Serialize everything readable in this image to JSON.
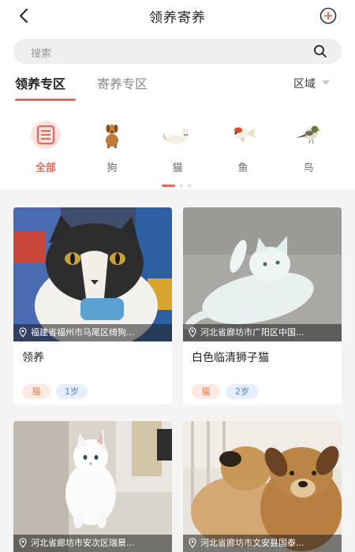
{
  "header": {
    "title": "领养寄养",
    "back_icon": "back-arrow-icon",
    "add_icon": "plus-circle-icon"
  },
  "search": {
    "placeholder": "搜索",
    "icon": "search-icon"
  },
  "tabs": [
    {
      "label": "领养专区",
      "active": true
    },
    {
      "label": "寄养专区",
      "active": false
    }
  ],
  "region": {
    "label": "区域"
  },
  "categories": [
    {
      "label": "全部",
      "icon": "all-list-icon",
      "active": true
    },
    {
      "label": "狗",
      "icon": "dog-icon",
      "active": false
    },
    {
      "label": "猫",
      "icon": "cat-icon",
      "active": false
    },
    {
      "label": "鱼",
      "icon": "fish-icon",
      "active": false
    },
    {
      "label": "鸟",
      "icon": "bird-icon",
      "active": false
    }
  ],
  "pager": {
    "pages": 3,
    "current": 1
  },
  "cards": [
    {
      "location": "福建省福州市马尾区绮狗...",
      "title": "领养",
      "type": "猫",
      "age": "1岁"
    },
    {
      "location": "河北省廊坊市广阳区中国...",
      "title": "白色临清狮子猫",
      "type": "猫",
      "age": "2岁"
    },
    {
      "location": "河北省廊坊市安次区瑞景..."
    },
    {
      "location": "河北省廊坊市文安县国泰..."
    }
  ],
  "colors": {
    "accent": "#e8695c",
    "tag_type_bg": "#fdebe3",
    "tag_age_bg": "#e6efff"
  }
}
